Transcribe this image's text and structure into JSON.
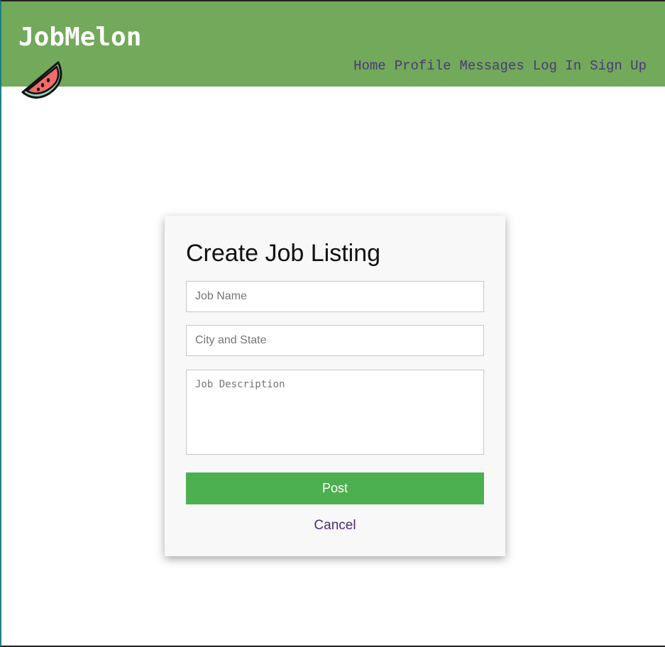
{
  "header": {
    "brand": "JobMelon",
    "logo_icon": "watermelon-icon",
    "background": "#72a95a",
    "nav": {
      "home": "Home",
      "profile": "Profile",
      "messages": "Messages",
      "login": "Log In",
      "signup": "Sign Up"
    }
  },
  "form": {
    "title": "Create Job Listing",
    "job_name_placeholder": "Job Name",
    "city_state_placeholder": "City and State",
    "description_placeholder": "Job Description",
    "post_label": "Post",
    "cancel_label": "Cancel",
    "post_color": "#4caf50"
  }
}
